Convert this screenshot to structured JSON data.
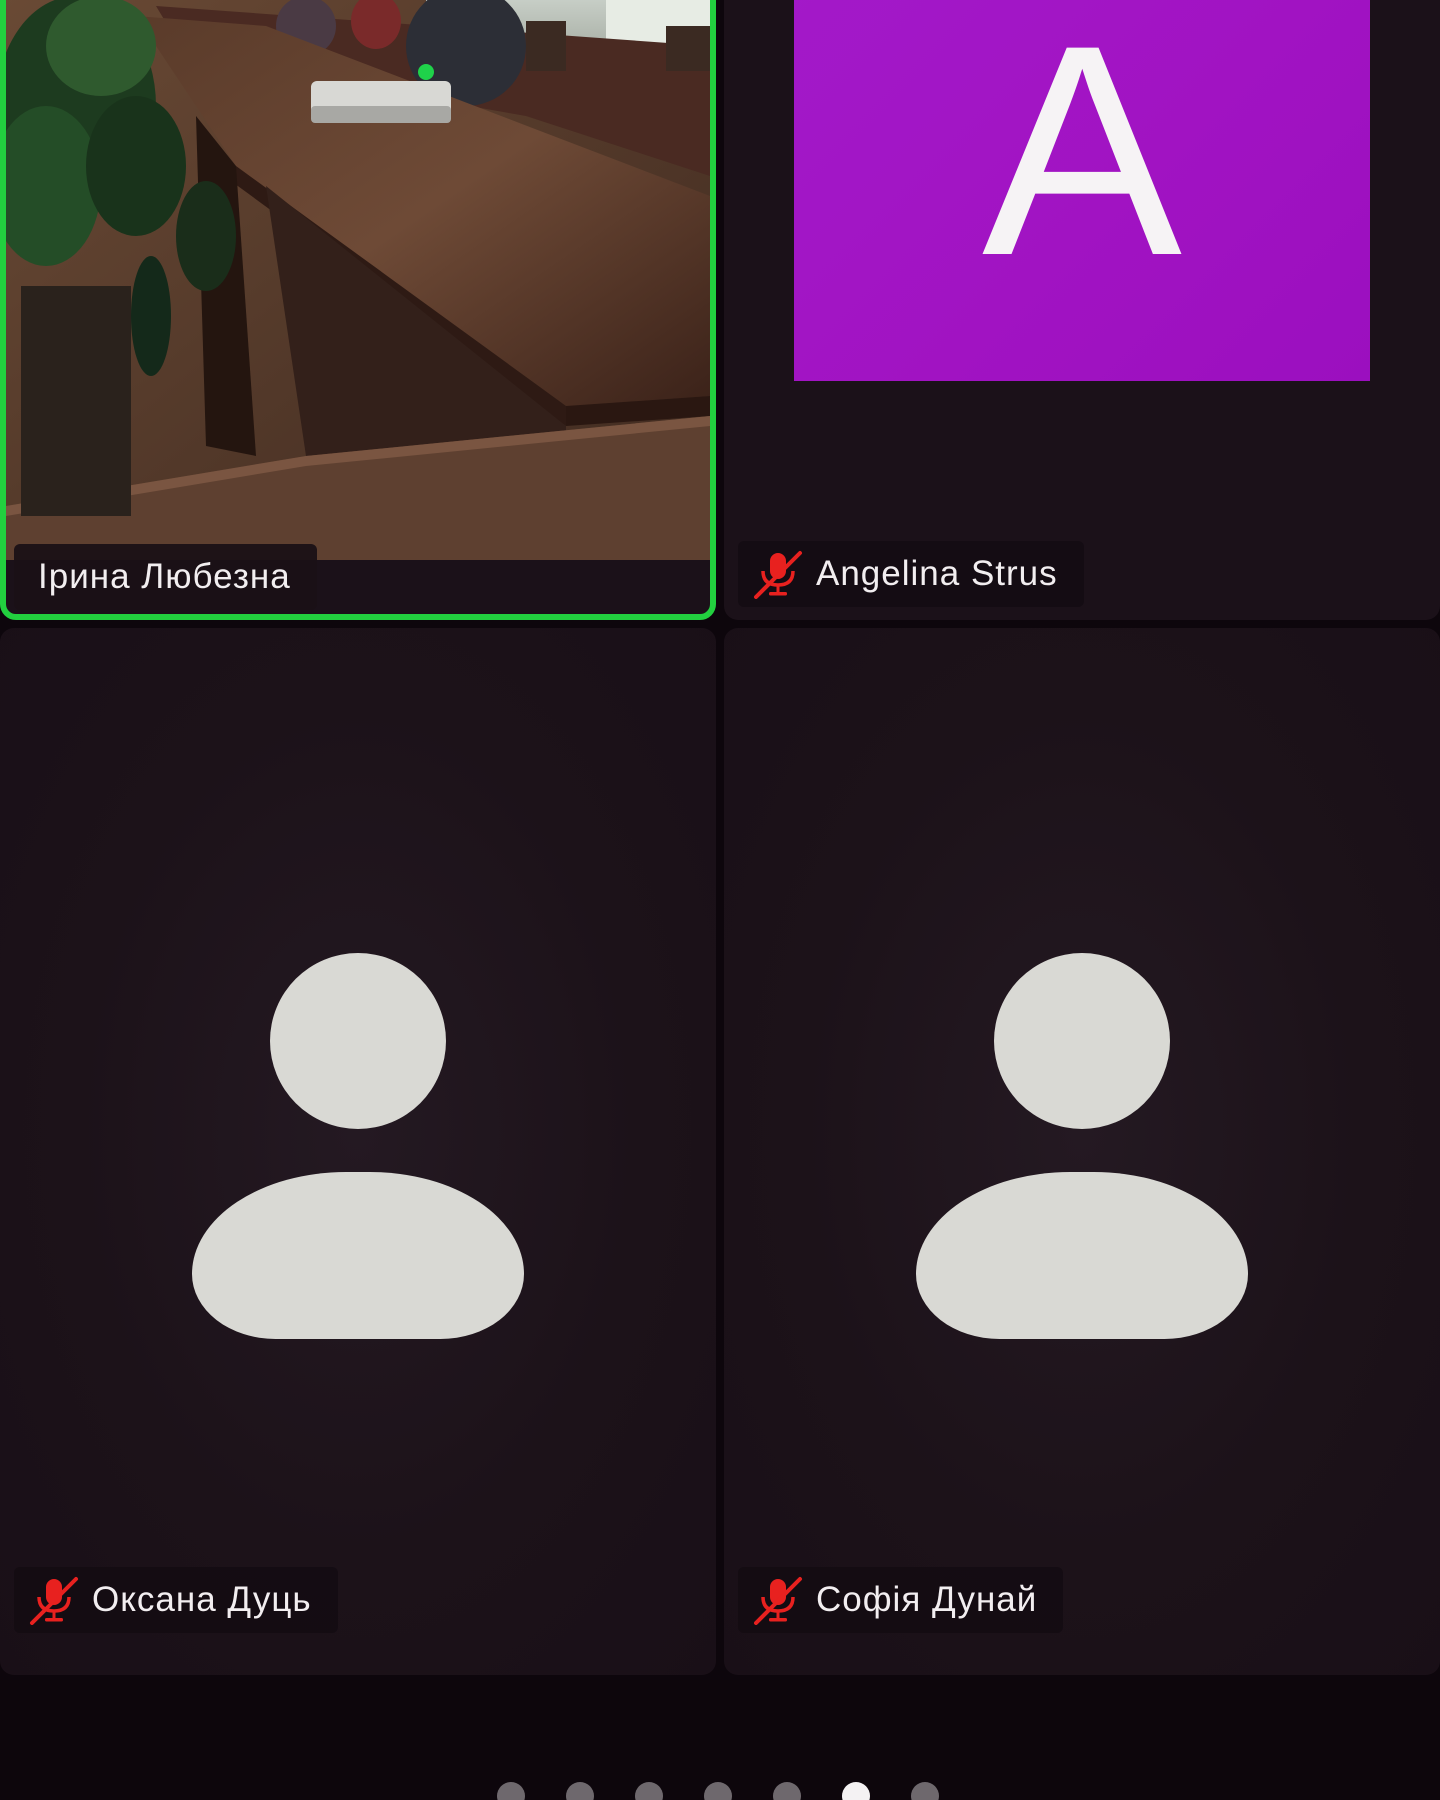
{
  "participants": [
    {
      "name": "Ірина Любезна",
      "muted": false,
      "video": "camera",
      "active_speaker": true
    },
    {
      "name": "Angelina Strus",
      "muted": true,
      "video": "avatar-letter",
      "avatar_letter": "A",
      "avatar_color": "#a316c6"
    },
    {
      "name": "Оксана Дуць",
      "muted": true,
      "video": "placeholder"
    },
    {
      "name": "Софія Дунай",
      "muted": true,
      "video": "placeholder"
    }
  ],
  "pagination": {
    "page_count": 7,
    "current_page": 6
  },
  "colors": {
    "active_speaker_border": "#22d03f",
    "muted_icon": "#e8211f",
    "background": "#0d060c"
  }
}
